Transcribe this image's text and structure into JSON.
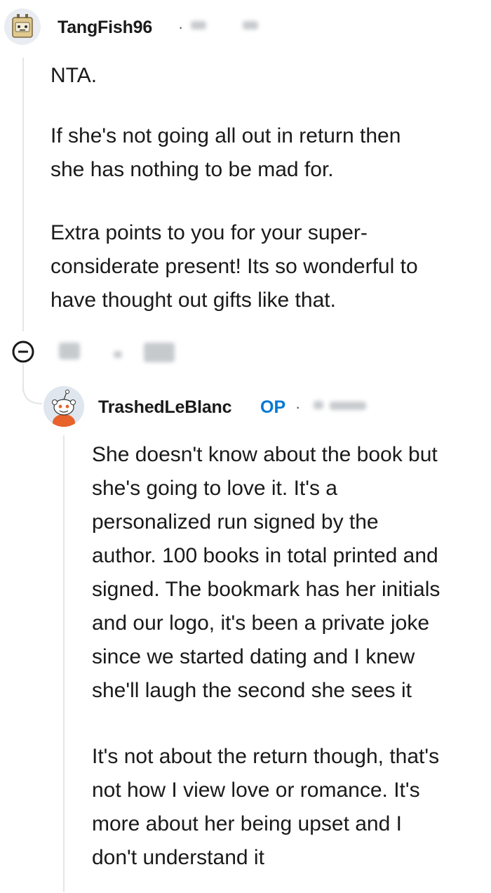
{
  "comment": {
    "author": "TangFish96",
    "paragraphs": [
      "NTA.",
      "If she's not going all out in return then\nshe has nothing to be mad for.",
      "Extra points to you for your super-\nconsiderate present! Its so wonderful to\nhave thought out gifts like that."
    ],
    "meta_separator": "·"
  },
  "reply": {
    "author": "TrashedLeBlanc",
    "badge": "OP",
    "meta_separator": "·",
    "paragraphs": [
      "She doesn't know about the book but\nshe's going to love it. It's a\npersonalized run signed by the\nauthor. 100 books in total printed and\nsigned. The bookmark has her initials\nand our logo, it's been a private joke\nsince we started dating and I knew\nshe'll laugh the second she sees it",
      "It's not about the return though, that's\nnot how I view love or romance. It's\nmore about her being upset and I\ndon't understand it"
    ]
  },
  "icons": {
    "collapse": "minus-circle-icon",
    "avatar_top": "robot-avatar-icon",
    "avatar_reply": "snoo-avatar-icon"
  },
  "colors": {
    "op_badge": "#0079d3",
    "thread_line": "#e3e5e8",
    "text": "#1a1a1b"
  }
}
